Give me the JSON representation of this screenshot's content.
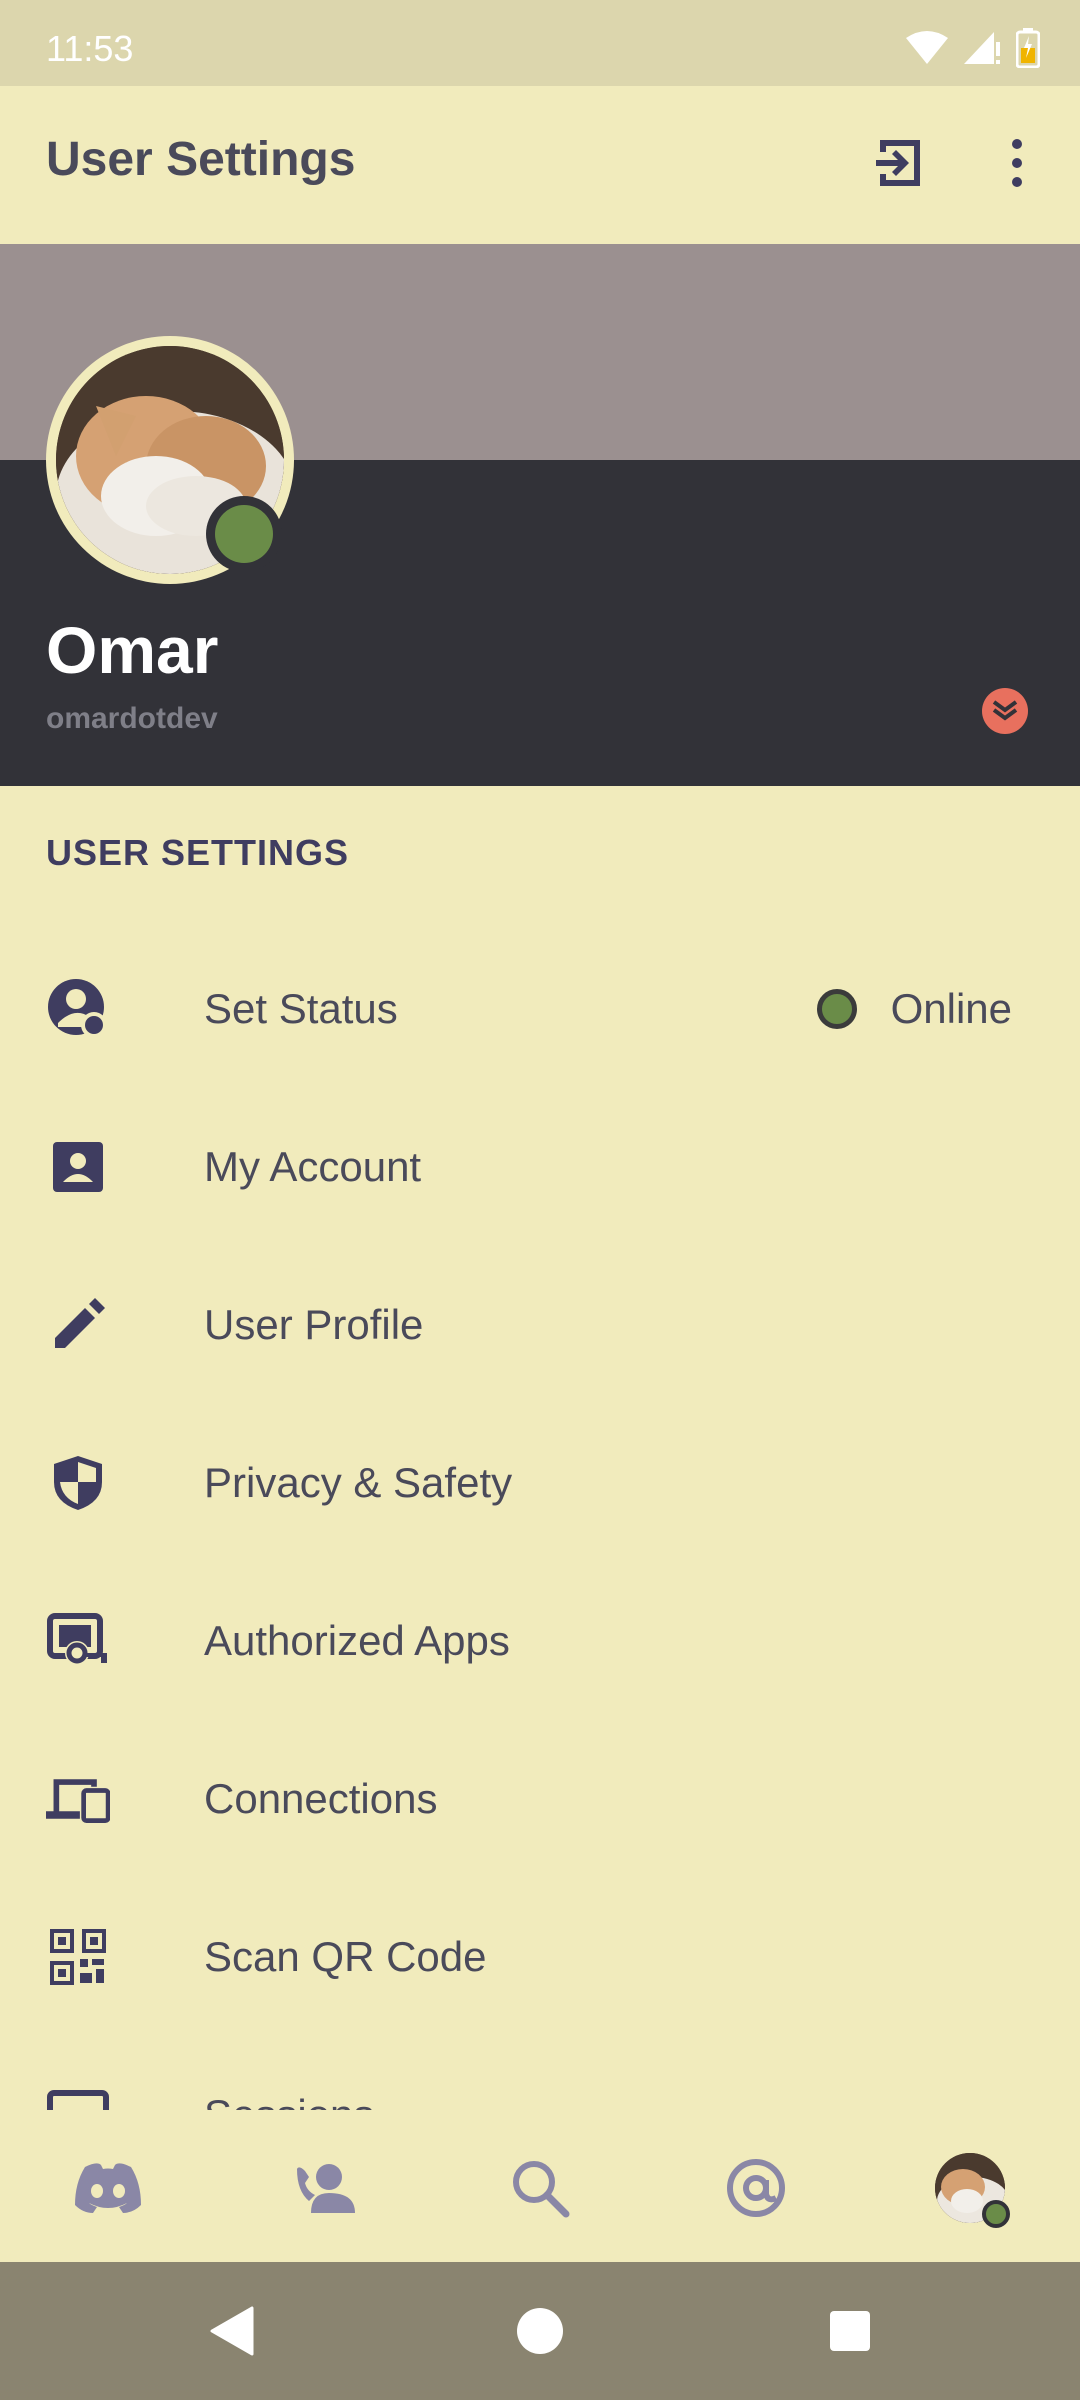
{
  "status_bar": {
    "time": "11:53"
  },
  "header": {
    "title": "User Settings"
  },
  "profile": {
    "name": "Omar",
    "handle": "omardotdev"
  },
  "section": {
    "label": "USER SETTINGS"
  },
  "settings": {
    "items": [
      {
        "label": "Set Status",
        "icon": "user-status-icon",
        "value": "Online"
      },
      {
        "label": "My Account",
        "icon": "account-card-icon"
      },
      {
        "label": "User Profile",
        "icon": "pencil-icon"
      },
      {
        "label": "Privacy & Safety",
        "icon": "shield-icon"
      },
      {
        "label": "Authorized Apps",
        "icon": "authorized-apps-icon"
      },
      {
        "label": "Connections",
        "icon": "devices-icon"
      },
      {
        "label": "Scan QR Code",
        "icon": "qr-code-icon"
      },
      {
        "label": "Sessions",
        "icon": "sessions-icon"
      }
    ]
  },
  "colors": {
    "accent_online": "#6a8c48",
    "background": "#f1ebbc",
    "profile_dark": "#323238",
    "banner": "#9b9090"
  }
}
